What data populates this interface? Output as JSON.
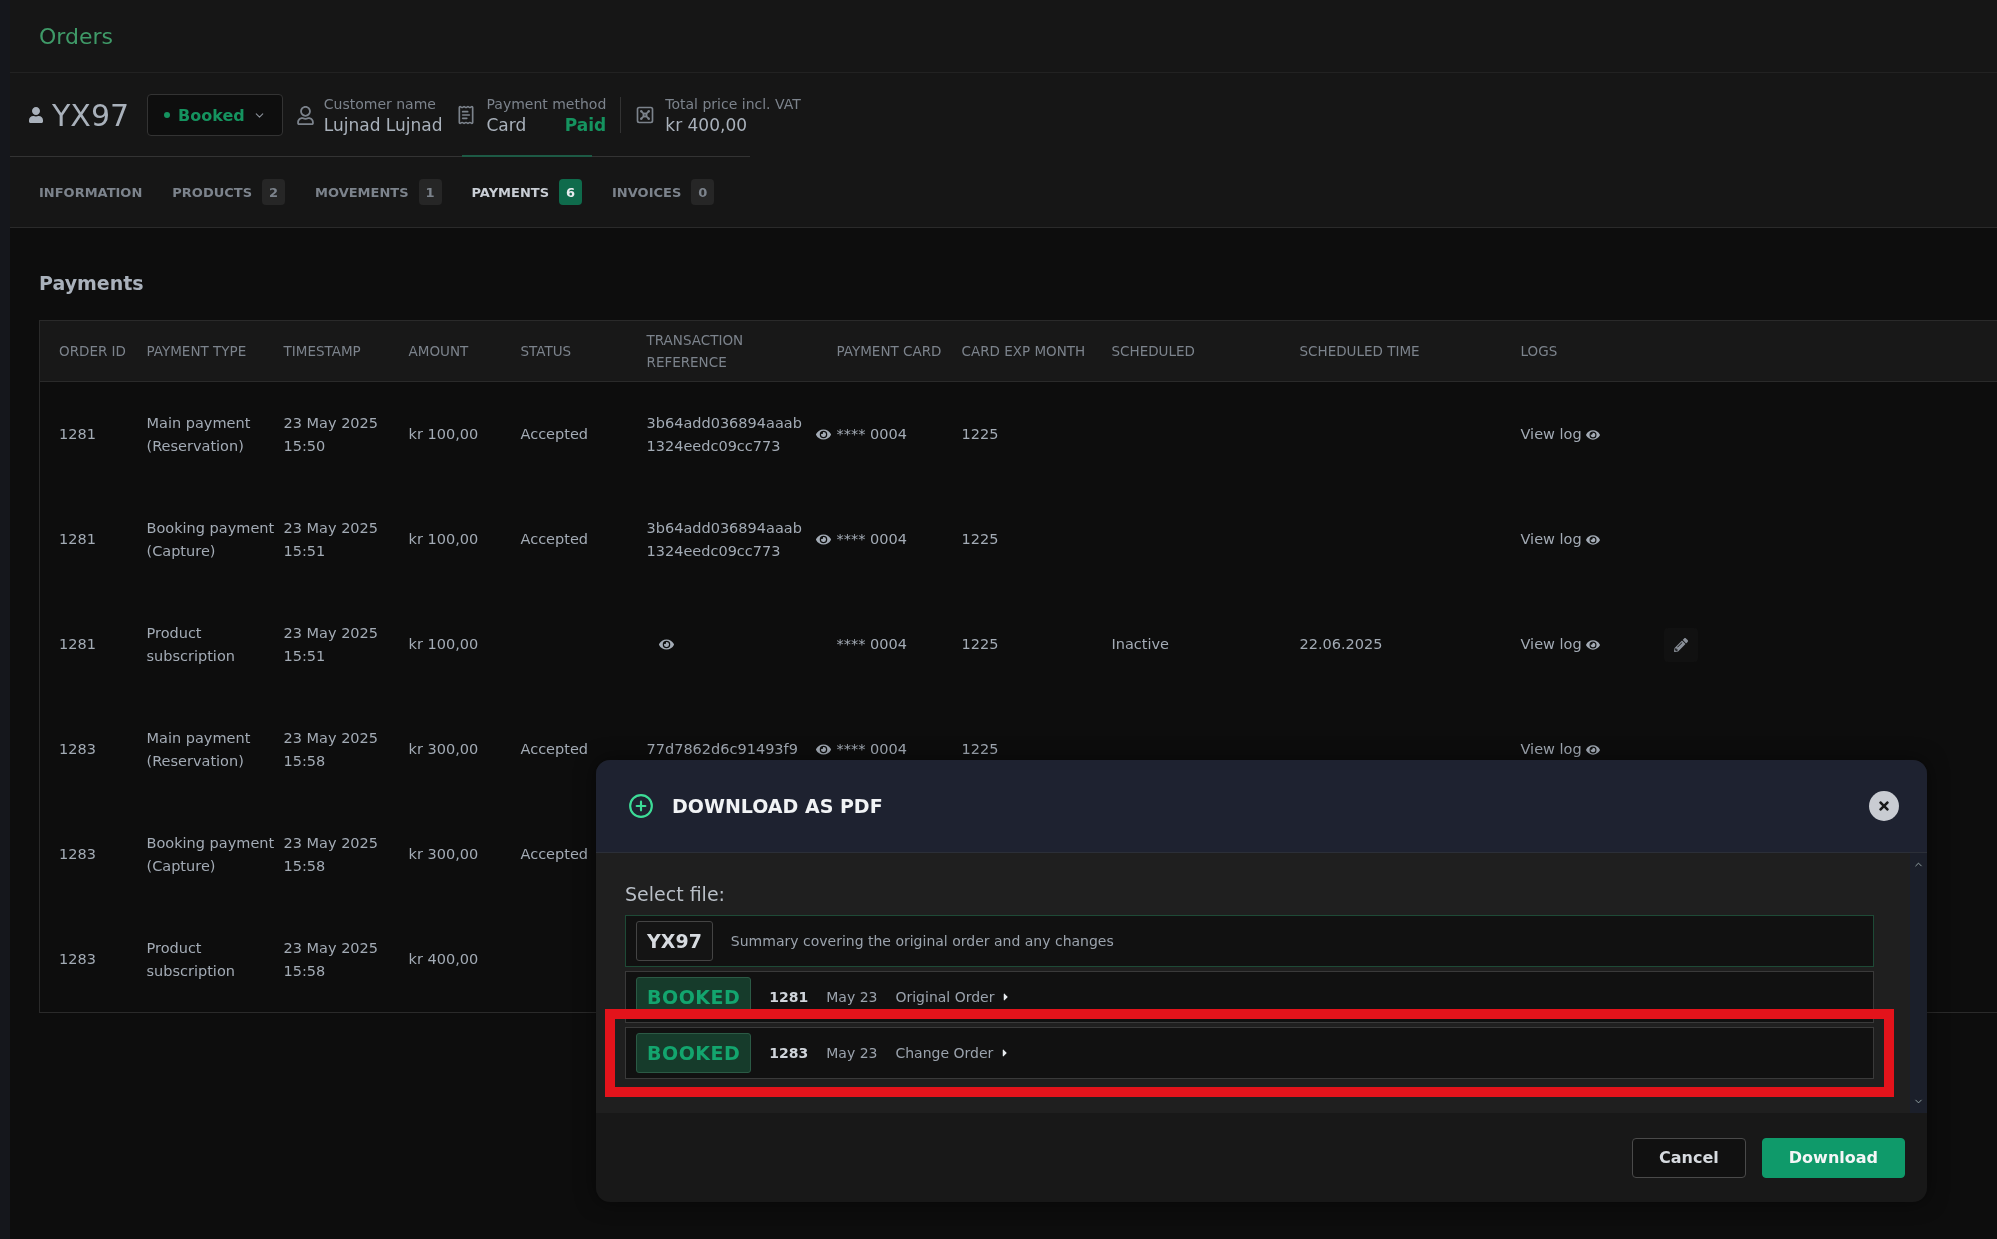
{
  "page_title": "Orders",
  "order": {
    "code": "YX97",
    "status": {
      "label": "Booked"
    },
    "customer": {
      "label": "Customer name",
      "value": "Lujnad Lujnad"
    },
    "payment": {
      "label": "Payment method",
      "value": "Card",
      "state": "Paid"
    },
    "total": {
      "label": "Total price incl. VAT",
      "value": "kr 400,00"
    }
  },
  "tabs": [
    {
      "label": "INFORMATION",
      "selected": false
    },
    {
      "label": "PRODUCTS",
      "count": "2",
      "selected": false
    },
    {
      "label": "MOVEMENTS",
      "count": "1",
      "selected": false
    },
    {
      "label": "PAYMENTS",
      "count": "6",
      "selected": true
    },
    {
      "label": "INVOICES",
      "count": "0",
      "selected": false
    }
  ],
  "section_title": "Payments",
  "table": {
    "columns": [
      "ORDER ID",
      "PAYMENT TYPE",
      "TIMESTAMP",
      "AMOUNT",
      "STATUS",
      "TRANSACTION REFERENCE",
      "PAYMENT CARD",
      "CARD EXP MONTH",
      "SCHEDULED",
      "SCHEDULED TIME",
      "LOGS"
    ],
    "rows": [
      {
        "order_id": "1281",
        "payment_type": "Main payment (Reservation)",
        "timestamp": "23 May 2025 15:50",
        "amount": "kr 100,00",
        "status": "Accepted",
        "reference": "3b64add036894aaab 1324eedc09cc773",
        "card": "**** 0004",
        "exp_month": "1225",
        "log": "View log",
        "editable": false
      },
      {
        "order_id": "1281",
        "payment_type": "Booking payment (Capture)",
        "timestamp": "23 May 2025 15:51",
        "amount": "kr 100,00",
        "status": "Accepted",
        "reference": "3b64add036894aaab 1324eedc09cc773",
        "card": "**** 0004",
        "exp_month": "1225",
        "log": "View log",
        "editable": false
      },
      {
        "order_id": "1281",
        "payment_type": "Product subscription",
        "timestamp": "23 May 2025 15:51",
        "amount": "kr 100,00",
        "card": "**** 0004",
        "exp_month": "1225",
        "scheduled": "Inactive",
        "scheduled_time": "22.06.2025",
        "log": "View log",
        "editable": true
      },
      {
        "order_id": "1283",
        "payment_type": "Main payment (Reservation)",
        "timestamp": "23 May 2025 15:58",
        "amount": "kr 300,00",
        "status": "Accepted",
        "reference": "77d7862d6c91493f9",
        "card": "**** 0004",
        "exp_month": "1225",
        "log": "View log",
        "editable": false
      },
      {
        "order_id": "1283",
        "payment_type": "Booking payment (Capture)",
        "timestamp": "23 May 2025 15:58",
        "amount": "kr 300,00",
        "status": "Accepted"
      },
      {
        "order_id": "1283",
        "payment_type": "Product subscription",
        "timestamp": "23 May 2025 15:58",
        "amount": "kr 400,00"
      }
    ]
  },
  "dialog": {
    "title": "DOWNLOAD AS PDF",
    "prompt": "Select file:",
    "files": [
      {
        "kind": "summary",
        "badge": "YX97",
        "text": "Summary covering the original order and any changes",
        "highlighted": false
      },
      {
        "kind": "order",
        "badge": "BOOKED",
        "number": "1281",
        "date": "May 23",
        "text": "Original Order",
        "highlighted": false
      },
      {
        "kind": "order",
        "badge": "BOOKED",
        "number": "1283",
        "date": "May 23",
        "text": "Change Order",
        "highlighted": true
      }
    ],
    "buttons": [
      {
        "label": "Cancel",
        "kind": "secondary"
      },
      {
        "label": "Download",
        "kind": "primary"
      }
    ]
  }
}
